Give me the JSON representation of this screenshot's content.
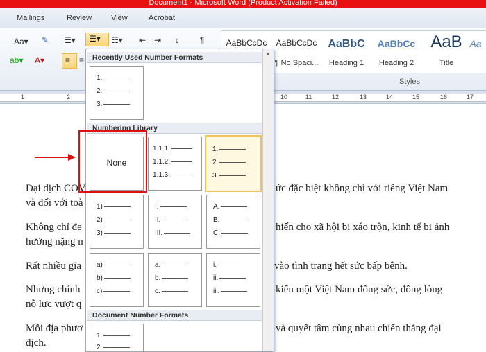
{
  "title": "Document1 - Microsoft Word (Product Activation Failed)",
  "tabs": [
    "Mailings",
    "Review",
    "View",
    "Acrobat"
  ],
  "styles": {
    "label": "Styles",
    "tiles": [
      {
        "preview": "AaBbCcDc",
        "name": ""
      },
      {
        "preview": "AaBbCcDc",
        "name": "¶ No Spaci..."
      },
      {
        "preview": "AaBbC",
        "name": "Heading 1"
      },
      {
        "preview": "AaBbCc",
        "name": "Heading 2"
      },
      {
        "preview": "AaB",
        "name": "Title"
      },
      {
        "preview": "Aa",
        "name": ""
      }
    ]
  },
  "ruler": {
    "numbers": [
      "1",
      "2",
      "10",
      "11",
      "12",
      "13",
      "14",
      "15",
      "16",
      "17"
    ]
  },
  "numbering_dropdown": {
    "recent_header": "Recently Used Number Formats",
    "library_header": "Numbering Library",
    "document_header": "Document Number Formats",
    "none_label": "None",
    "recent_format": [
      "1.",
      "2.",
      "3."
    ],
    "library": [
      [
        "1.1.1.",
        "1.1.2.",
        "1.1.3."
      ],
      [
        "1.",
        "2.",
        "3."
      ],
      [
        "1)",
        "2)",
        "3)"
      ],
      [
        "I.",
        "II.",
        "III."
      ],
      [
        "A.",
        "B.",
        "C."
      ],
      [
        "a)",
        "b)",
        "c)"
      ],
      [
        "a.",
        "b.",
        "c."
      ],
      [
        "i.",
        "ii.",
        "iii."
      ]
    ],
    "document_format": [
      "1.",
      "2."
    ]
  },
  "document": {
    "p1_left": "Đại dịch COV",
    "p1_right": "ức đặc biệt không chỉ với riêng Việt Nam",
    "p1_line2": "và đối với toà",
    "p2_left": "Không chỉ đe",
    "p2_right": "hiến cho xã hội bị xáo trộn, kinh tế bị ảnh",
    "p2_line2": "hưởng nặng n",
    "p3_left": "Rất nhiều gia",
    "p3_right": "vào tình trạng hết sức bấp bênh.",
    "p4_left": "Nhưng chính",
    "p4_right": "kiến một Việt Nam đồng sức, đồng lòng",
    "p4_line2": "nỗ lực vượt q",
    "p5_left": "Mỗi địa phươ",
    "p5_right": "và quyết tâm cùng nhau chiến thắng đại",
    "p5_line2": "dịch."
  },
  "colors": {
    "titlebar": "#e81010",
    "highlight": "#f2c25a",
    "annotation": "#e01010"
  }
}
